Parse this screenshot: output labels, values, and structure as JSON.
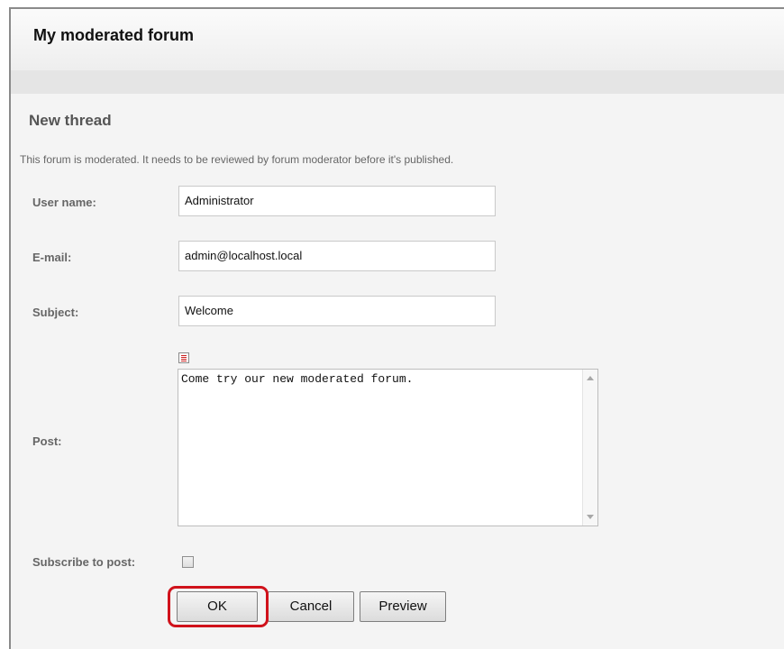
{
  "header": {
    "title": "My moderated forum"
  },
  "form": {
    "section_title": "New thread",
    "notice": "This forum is moderated. It needs to be reviewed by forum moderator before it's published.",
    "user_name": {
      "label": "User name:",
      "value": "Administrator"
    },
    "email": {
      "label": "E-mail:",
      "value": "admin@localhost.local"
    },
    "subject": {
      "label": "Subject:",
      "value": "Welcome"
    },
    "post": {
      "label": "Post:",
      "value": "Come try our new moderated forum."
    },
    "subscribe": {
      "label": "Subscribe to post:",
      "checked": false
    }
  },
  "buttons": {
    "ok": "OK",
    "cancel": "Cancel",
    "preview": "Preview"
  },
  "colors": {
    "highlight": "#d0121b",
    "header_bg": "#f4f4f4",
    "label": "#666666"
  },
  "icons": {
    "editor_toggle": "format-text-icon"
  }
}
